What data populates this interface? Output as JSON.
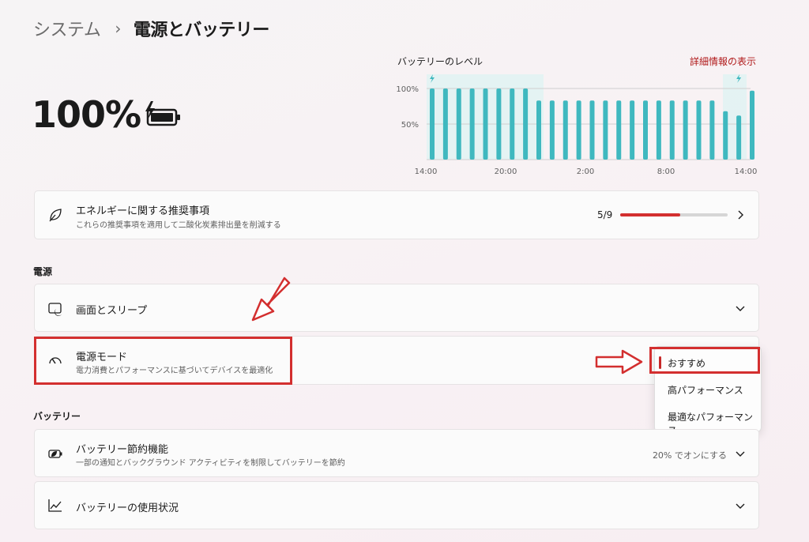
{
  "breadcrumb": {
    "parent": "システム",
    "separator": "›",
    "current": "電源とバッテリー"
  },
  "battery": {
    "percent": "100%"
  },
  "chart_data": {
    "type": "bar",
    "title": "バッテリーのレベル",
    "xlabel": "",
    "ylabel": "",
    "ylim": [
      0,
      100
    ],
    "y_ticks": [
      "100%",
      "50%"
    ],
    "x_ticks": [
      "14:00",
      "20:00",
      "2:00",
      "8:00",
      "14:00"
    ],
    "values": [
      100,
      100,
      100,
      100,
      100,
      100,
      100,
      100,
      83,
      83,
      83,
      83,
      83,
      83,
      83,
      83,
      83,
      83,
      83,
      83,
      83,
      83,
      68,
      62,
      97
    ],
    "charging_indices": [
      0,
      23
    ],
    "grid": true
  },
  "details_link": "詳細情報の表示",
  "energy": {
    "title": "エネルギーに関する推奨事項",
    "subtitle": "これらの推奨事項を適用して二酸化炭素排出量を削減する",
    "progress_text": "5/9",
    "progress_fraction": 0.5556
  },
  "sections": {
    "power": "電源",
    "battery": "バッテリー"
  },
  "screen_sleep": {
    "title": "画面とスリープ"
  },
  "power_mode": {
    "title": "電源モード",
    "subtitle": "電力消費とパフォーマンスに基づいてデバイスを最適化",
    "options": [
      "おすすめ",
      "高パフォーマンス",
      "最適なパフォーマンス"
    ],
    "selected": "おすすめ"
  },
  "battery_saver": {
    "title": "バッテリー節約機能",
    "subtitle": "一部の通知とバックグラウンド アクティビティを制限してバッテリーを節約",
    "value": "20% でオンにする"
  },
  "battery_usage": {
    "title": "バッテリーの使用状況"
  },
  "colors": {
    "accent": "#d32f2f",
    "bar": "#3fb8bf",
    "bar_bg": "#dff3f3",
    "progress_track": "#d6d6d6"
  }
}
